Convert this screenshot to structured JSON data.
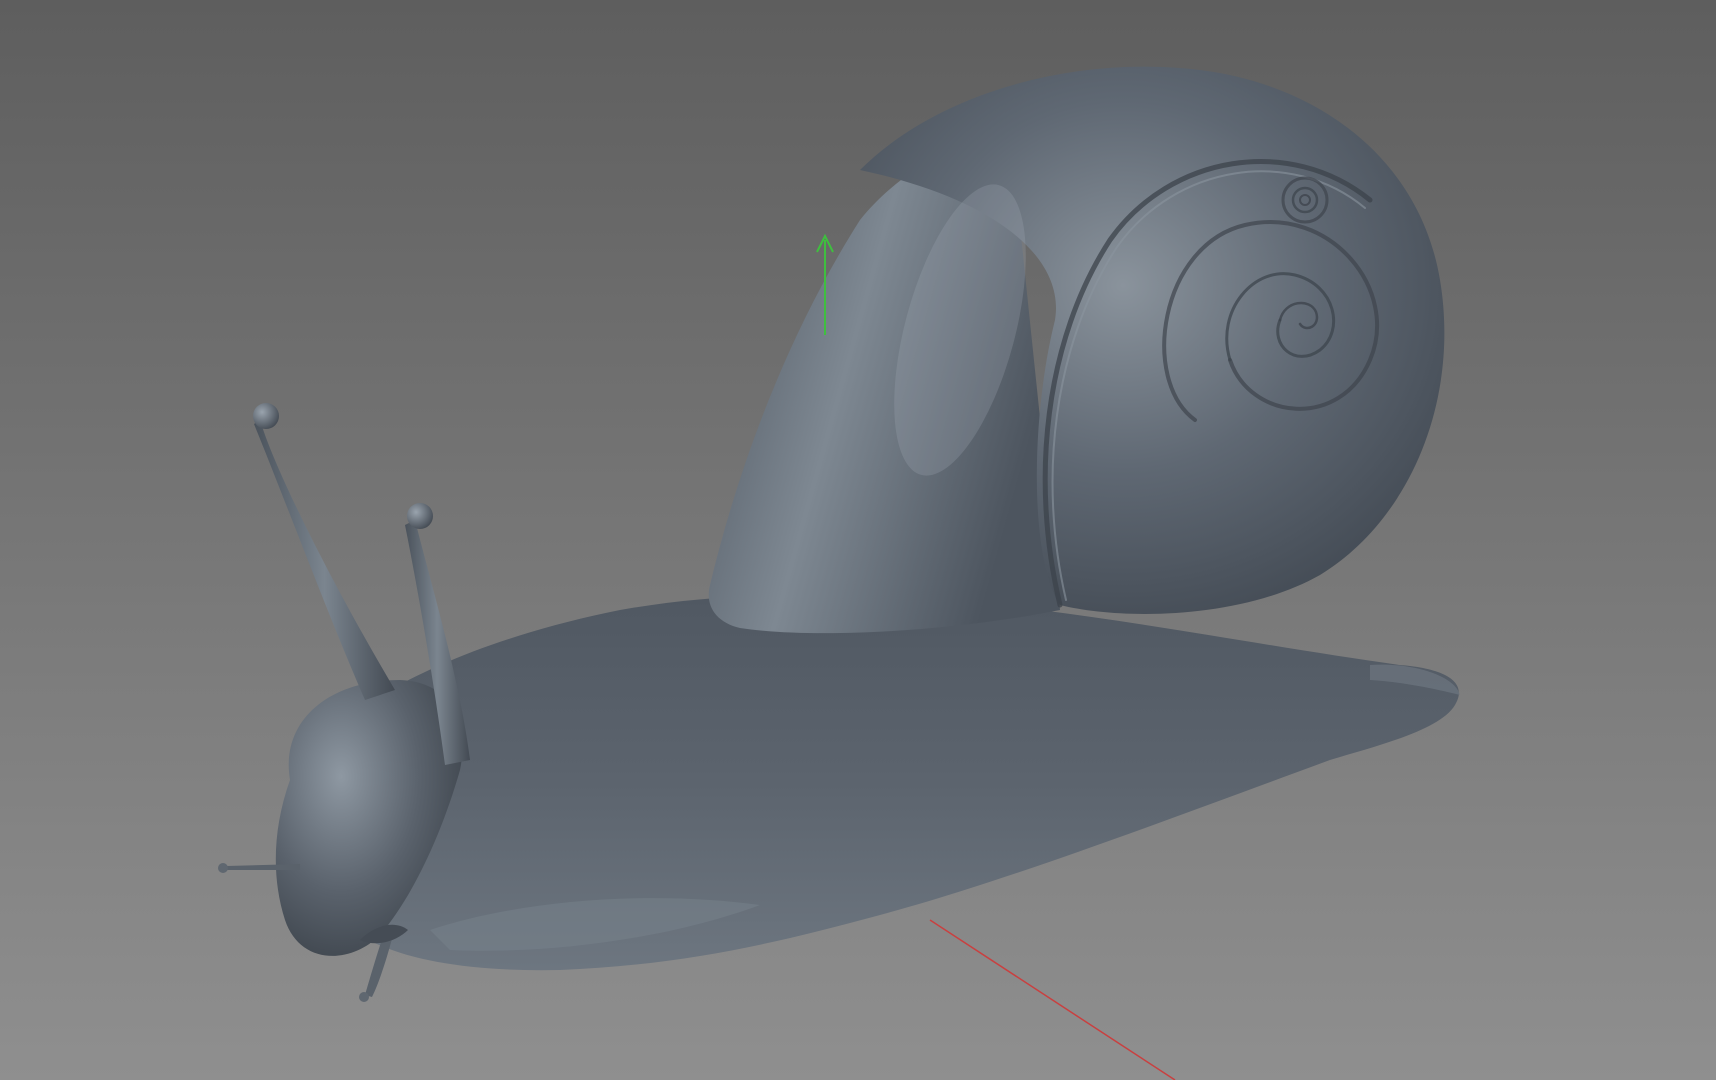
{
  "viewport": {
    "name": "3d-perspective-viewport",
    "background_top": "#5f5f5f",
    "background_bottom": "#8e8e8e",
    "object": "snail-model",
    "material_color": "#5b636c",
    "axes": {
      "y_axis_color": "#3fbf3f",
      "x_axis_color": "#c94040"
    }
  }
}
